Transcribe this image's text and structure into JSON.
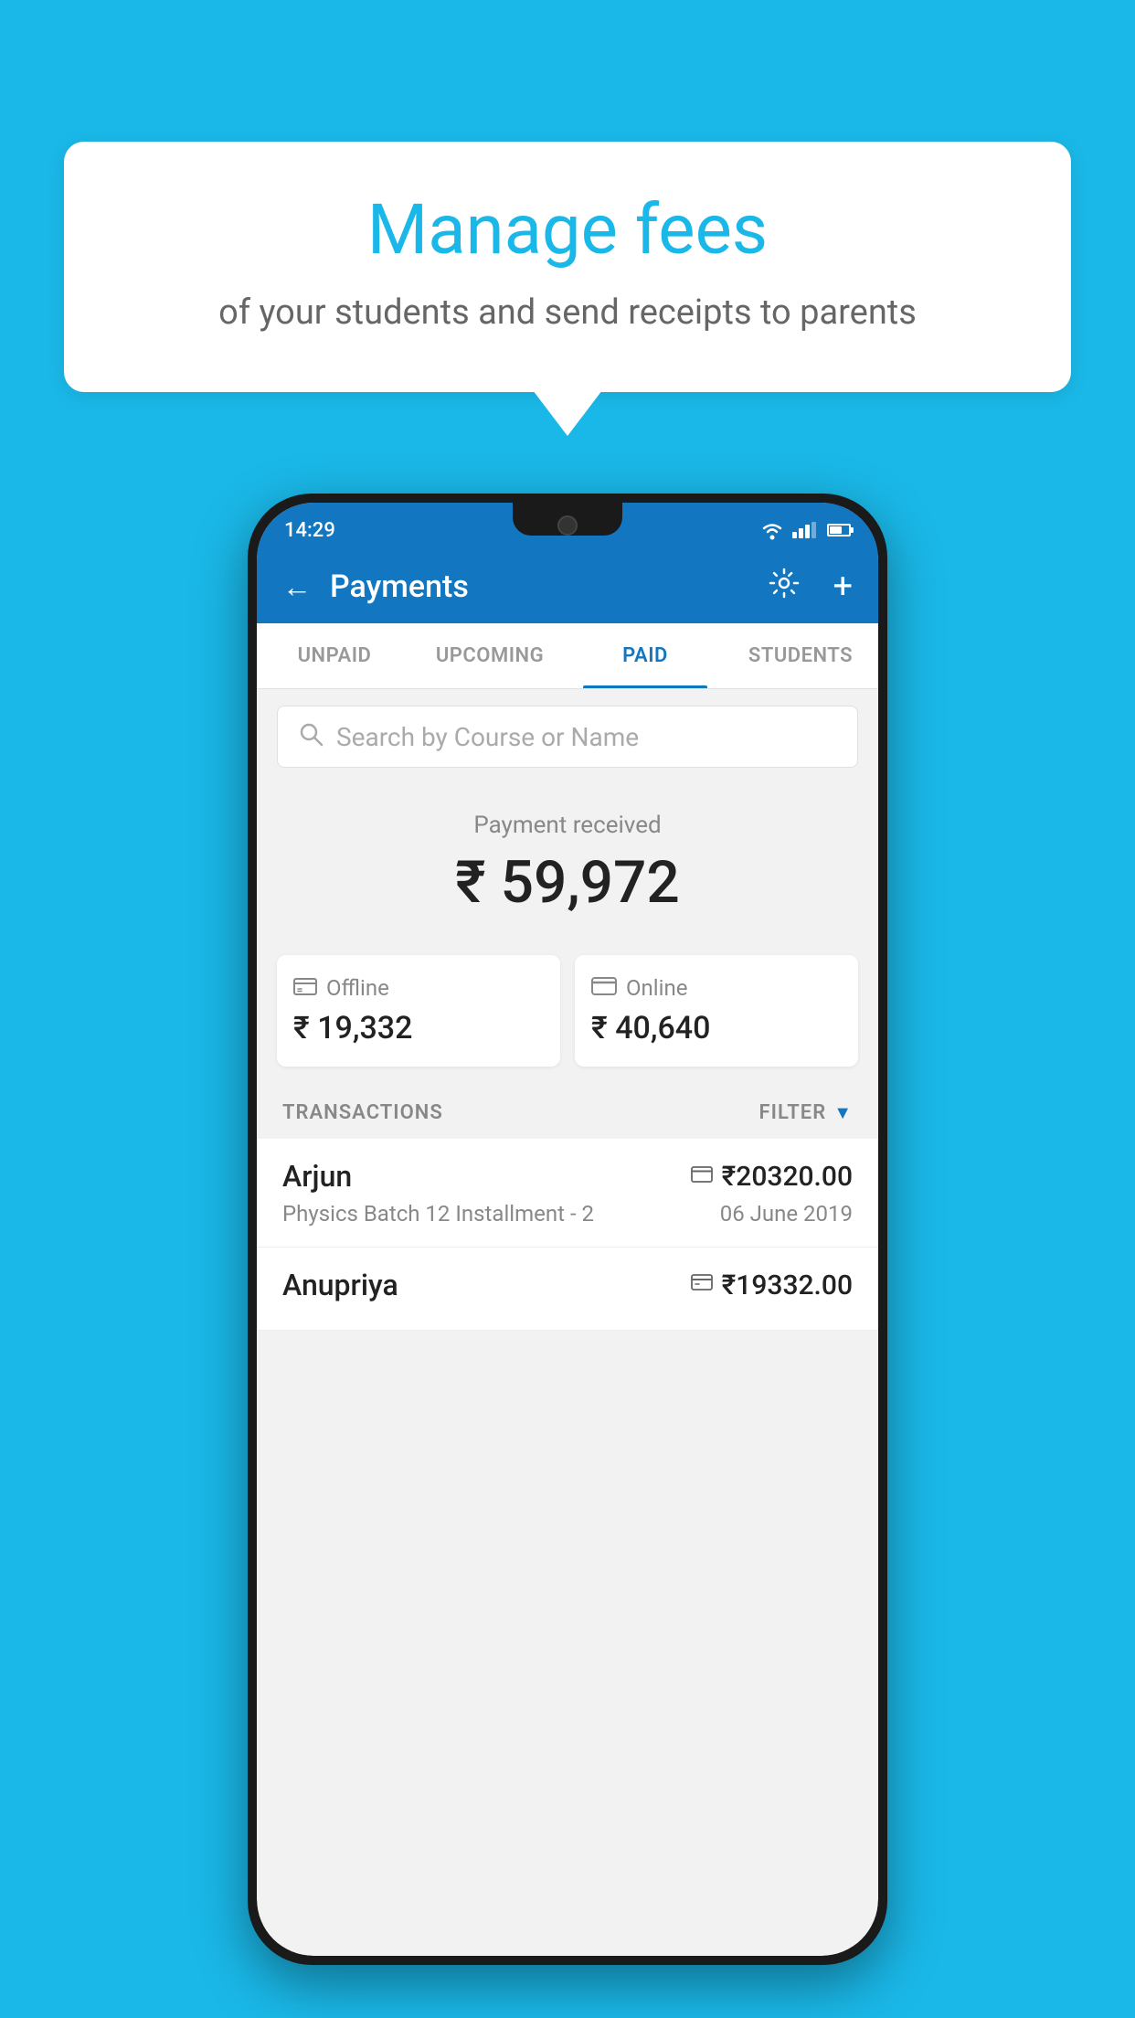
{
  "background_color": "#1ab8e8",
  "speech_bubble": {
    "title": "Manage fees",
    "subtitle": "of your students and send receipts to parents"
  },
  "status_bar": {
    "time": "14:29"
  },
  "header": {
    "title": "Payments",
    "back_label": "←",
    "settings_label": "⚙",
    "add_label": "+"
  },
  "tabs": [
    {
      "label": "UNPAID",
      "active": false
    },
    {
      "label": "UPCOMING",
      "active": false
    },
    {
      "label": "PAID",
      "active": true
    },
    {
      "label": "STUDENTS",
      "active": false
    }
  ],
  "search": {
    "placeholder": "Search by Course or Name"
  },
  "payment_summary": {
    "label": "Payment received",
    "amount": "₹ 59,972",
    "offline_label": "Offline",
    "offline_amount": "₹ 19,332",
    "online_label": "Online",
    "online_amount": "₹ 40,640"
  },
  "transactions": {
    "header_label": "TRANSACTIONS",
    "filter_label": "FILTER",
    "items": [
      {
        "name": "Arjun",
        "description": "Physics Batch 12 Installment - 2",
        "amount": "₹20320.00",
        "date": "06 June 2019",
        "type": "online"
      },
      {
        "name": "Anupriya",
        "description": "",
        "amount": "₹19332.00",
        "date": "",
        "type": "offline"
      }
    ]
  }
}
